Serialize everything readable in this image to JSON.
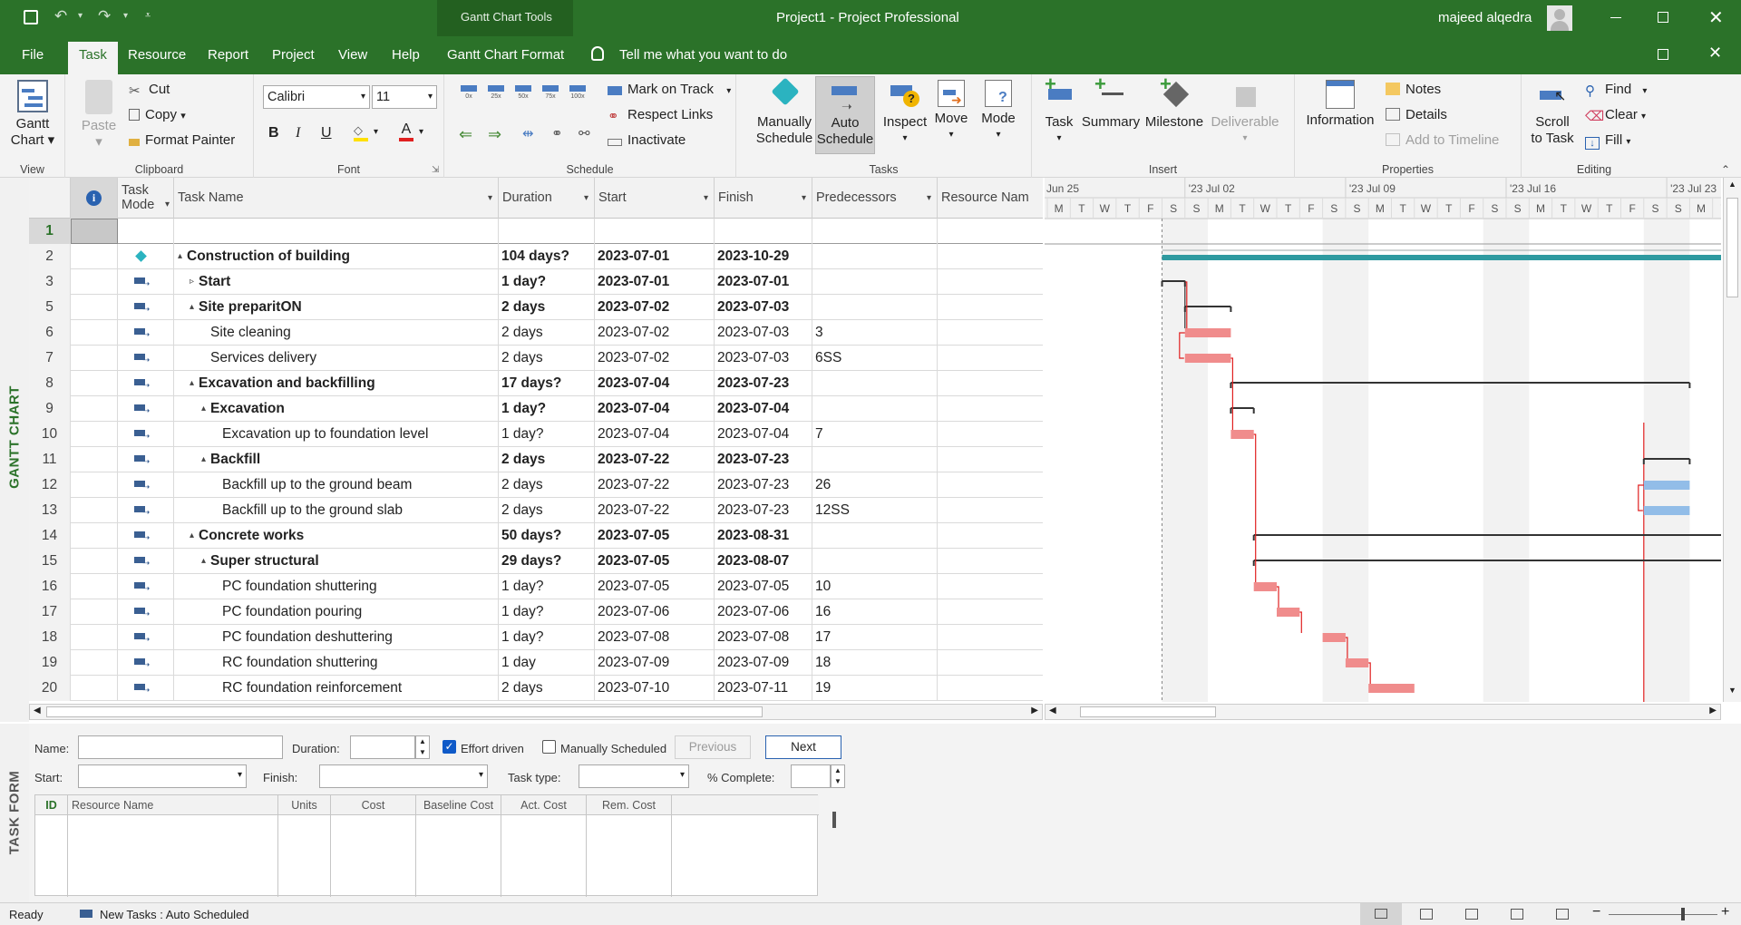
{
  "titlebar": {
    "tools": "Gantt Chart Tools",
    "title": "Project1  -  Project Professional",
    "user": "majeed alqedra"
  },
  "tabs": [
    "File",
    "Task",
    "Resource",
    "Report",
    "Project",
    "View",
    "Help",
    "Gantt Chart Format",
    "Tell me what you want to do"
  ],
  "ribbon": {
    "view_group": "View",
    "gantt_chart": [
      "Gantt",
      "Chart"
    ],
    "clipboard_group": "Clipboard",
    "paste": "Paste",
    "cut": "Cut",
    "copy": "Copy",
    "format_painter": "Format Painter",
    "font_group": "Font",
    "font_name": "Calibri",
    "font_size": "11",
    "schedule_group": "Schedule",
    "pct_labels": [
      "0x",
      "25x",
      "50x",
      "75x",
      "100x"
    ],
    "mark_on_track": "Mark on Track",
    "respect_links": "Respect Links",
    "inactivate": "Inactivate",
    "tasks_group": "Tasks",
    "manually_schedule": [
      "Manually",
      "Schedule"
    ],
    "auto_schedule": [
      "Auto",
      "Schedule"
    ],
    "inspect": "Inspect",
    "move": "Move",
    "mode": "Mode",
    "insert_group": "Insert",
    "task": "Task",
    "summary": "Summary",
    "milestone": "Milestone",
    "deliverable": "Deliverable",
    "properties_group": "Properties",
    "information": "Information",
    "notes": "Notes",
    "details": "Details",
    "add_to_timeline": "Add to Timeline",
    "editing_group": "Editing",
    "scroll_to_task": [
      "Scroll",
      "to Task"
    ],
    "find": "Find",
    "clear": "Clear",
    "fill": "Fill"
  },
  "side_labels": {
    "gantt": "GANTT CHART",
    "form": "TASK FORM"
  },
  "grid": {
    "headers": {
      "task_mode": [
        "Task",
        "Mode"
      ],
      "task_name": "Task Name",
      "duration": "Duration",
      "start": "Start",
      "finish": "Finish",
      "predecessors": "Predecessors",
      "resource_names": "Resource Nam"
    },
    "rows": [
      {
        "id": "1",
        "name": "",
        "dur": "",
        "start": "",
        "finish": "",
        "pred": "",
        "level": 0,
        "bold": false,
        "mode": "none",
        "toggle": ""
      },
      {
        "id": "2",
        "name": "Construction of building",
        "dur": "104 days?",
        "start": "2023-07-01",
        "finish": "2023-10-29",
        "pred": "",
        "level": 0,
        "bold": true,
        "mode": "pin",
        "toggle": "▴"
      },
      {
        "id": "3",
        "name": "Start",
        "dur": "1 day?",
        "start": "2023-07-01",
        "finish": "2023-07-01",
        "pred": "",
        "level": 1,
        "bold": true,
        "mode": "auto",
        "toggle": "▹"
      },
      {
        "id": "5",
        "name": "Site preparitON",
        "dur": "2 days",
        "start": "2023-07-02",
        "finish": "2023-07-03",
        "pred": "",
        "level": 1,
        "bold": true,
        "mode": "auto",
        "toggle": "▴"
      },
      {
        "id": "6",
        "name": "Site cleaning",
        "dur": "2 days",
        "start": "2023-07-02",
        "finish": "2023-07-03",
        "pred": "3",
        "level": 2,
        "bold": false,
        "mode": "auto",
        "toggle": ""
      },
      {
        "id": "7",
        "name": "Services delivery",
        "dur": "2 days",
        "start": "2023-07-02",
        "finish": "2023-07-03",
        "pred": "6SS",
        "level": 2,
        "bold": false,
        "mode": "auto",
        "toggle": ""
      },
      {
        "id": "8",
        "name": "Excavation and backfilling",
        "dur": "17 days?",
        "start": "2023-07-04",
        "finish": "2023-07-23",
        "pred": "",
        "level": 1,
        "bold": true,
        "mode": "auto",
        "toggle": "▴"
      },
      {
        "id": "9",
        "name": "Excavation",
        "dur": "1 day?",
        "start": "2023-07-04",
        "finish": "2023-07-04",
        "pred": "",
        "level": 2,
        "bold": true,
        "mode": "auto",
        "toggle": "▴"
      },
      {
        "id": "10",
        "name": "Excavation up to foundation level",
        "dur": "1 day?",
        "start": "2023-07-04",
        "finish": "2023-07-04",
        "pred": "7",
        "level": 3,
        "bold": false,
        "mode": "auto",
        "toggle": ""
      },
      {
        "id": "11",
        "name": "Backfill",
        "dur": "2 days",
        "start": "2023-07-22",
        "finish": "2023-07-23",
        "pred": "",
        "level": 2,
        "bold": true,
        "mode": "auto",
        "toggle": "▴"
      },
      {
        "id": "12",
        "name": "Backfill up to  the ground beam",
        "dur": "2 days",
        "start": "2023-07-22",
        "finish": "2023-07-23",
        "pred": "26",
        "level": 3,
        "bold": false,
        "mode": "auto",
        "toggle": ""
      },
      {
        "id": "13",
        "name": "Backfill up to  the ground slab",
        "dur": "2 days",
        "start": "2023-07-22",
        "finish": "2023-07-23",
        "pred": "12SS",
        "level": 3,
        "bold": false,
        "mode": "auto",
        "toggle": ""
      },
      {
        "id": "14",
        "name": "Concrete works",
        "dur": "50 days?",
        "start": "2023-07-05",
        "finish": "2023-08-31",
        "pred": "",
        "level": 1,
        "bold": true,
        "mode": "auto",
        "toggle": "▴"
      },
      {
        "id": "15",
        "name": "Super structural",
        "dur": "29 days?",
        "start": "2023-07-05",
        "finish": "2023-08-07",
        "pred": "",
        "level": 2,
        "bold": true,
        "mode": "auto",
        "toggle": "▴"
      },
      {
        "id": "16",
        "name": "PC foundation shuttering",
        "dur": "1 day?",
        "start": "2023-07-05",
        "finish": "2023-07-05",
        "pred": "10",
        "level": 3,
        "bold": false,
        "mode": "auto",
        "toggle": ""
      },
      {
        "id": "17",
        "name": "PC foundation pouring",
        "dur": "1 day?",
        "start": "2023-07-06",
        "finish": "2023-07-06",
        "pred": "16",
        "level": 3,
        "bold": false,
        "mode": "auto",
        "toggle": ""
      },
      {
        "id": "18",
        "name": "PC foundation deshuttering",
        "dur": "1 day?",
        "start": "2023-07-08",
        "finish": "2023-07-08",
        "pred": "17",
        "level": 3,
        "bold": false,
        "mode": "auto",
        "toggle": ""
      },
      {
        "id": "19",
        "name": "RC foundation shuttering",
        "dur": "1 day",
        "start": "2023-07-09",
        "finish": "2023-07-09",
        "pred": "18",
        "level": 3,
        "bold": false,
        "mode": "auto",
        "toggle": ""
      },
      {
        "id": "20",
        "name": "RC foundation reinforcement",
        "dur": "2 days",
        "start": "2023-07-10",
        "finish": "2023-07-11",
        "pred": "19",
        "level": 3,
        "bold": false,
        "mode": "auto",
        "toggle": ""
      }
    ]
  },
  "timescale": {
    "weeks": [
      "Jun 25",
      "'23 Jul 02",
      "'23 Jul 09",
      "'23 Jul 16",
      "'23 Jul 23"
    ],
    "days": [
      "M",
      "T",
      "W",
      "T",
      "F",
      "S",
      "S",
      "M",
      "T",
      "W",
      "T",
      "F",
      "S",
      "S",
      "M",
      "T",
      "W",
      "T",
      "F",
      "S",
      "S",
      "M",
      "T",
      "W",
      "T",
      "F",
      "S",
      "S",
      "M",
      "T",
      "W",
      "T",
      "F",
      "S",
      "S",
      "M",
      "T"
    ],
    "first_day": "2023-06-26",
    "today_line": "2023-07-01",
    "status_date_line": "2023-07-22"
  },
  "task_form": {
    "name_label": "Name:",
    "duration_label": "Duration:",
    "effort_driven": "Effort driven",
    "effort_checked": true,
    "manually_scheduled": "Manually Scheduled",
    "manual_checked": false,
    "previous": "Previous",
    "next": "Next",
    "start_label": "Start:",
    "finish_label": "Finish:",
    "task_type_label": "Task type:",
    "complete_label": "% Complete:",
    "columns": [
      "ID",
      "Resource Name",
      "Units",
      "Cost",
      "Baseline Cost",
      "Act. Cost",
      "Rem. Cost"
    ]
  },
  "status": {
    "ready": "Ready",
    "new_tasks": "New Tasks : Auto Scheduled"
  },
  "colors": {
    "brand": "#2b7229",
    "crit_bar": "#f08c8c",
    "bar_blue": "#92bde8",
    "summary_bar": "#2e9aa0",
    "link_red": "#e02020"
  }
}
